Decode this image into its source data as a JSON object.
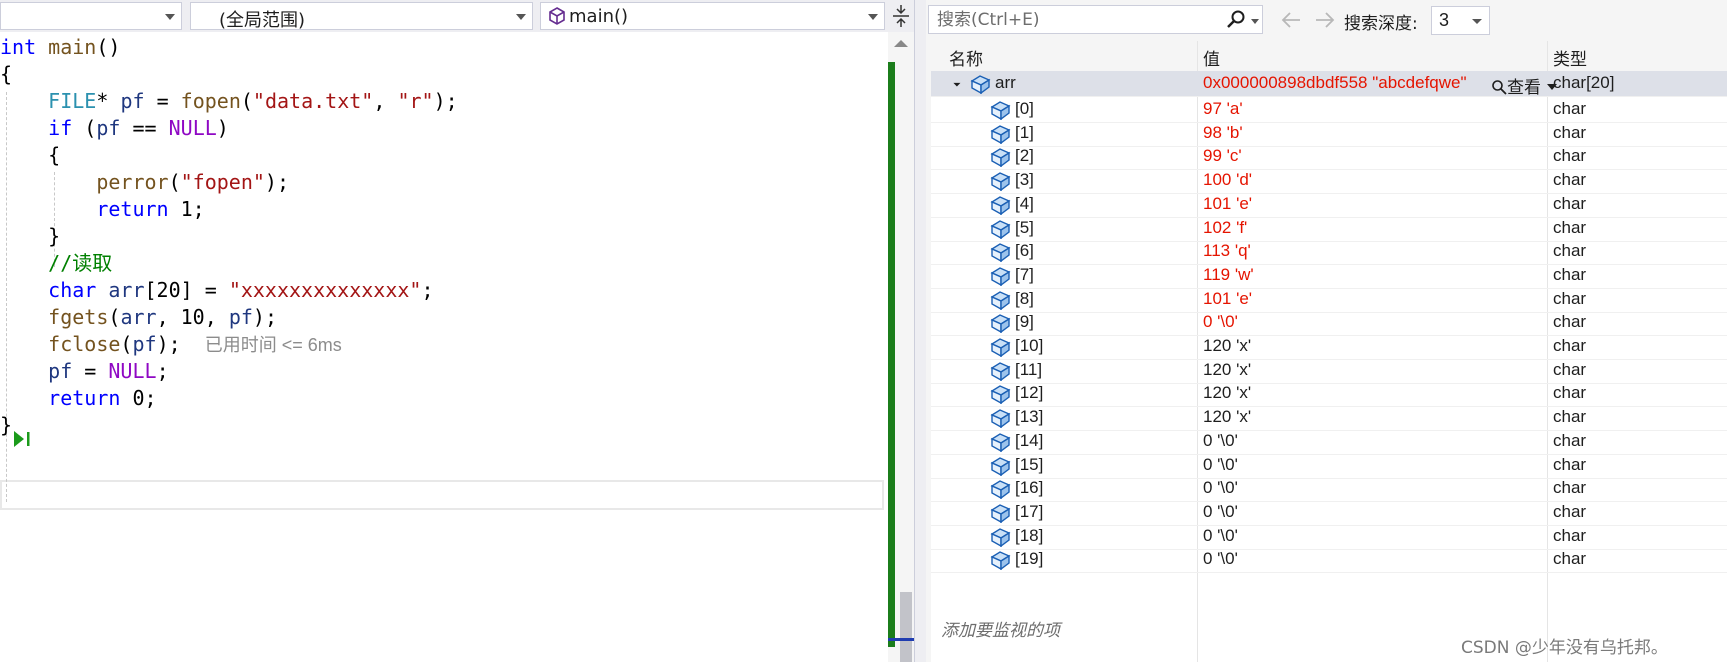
{
  "editor": {
    "nav": {
      "project": "",
      "scope": "(全局范围)",
      "function": "main()"
    },
    "lines": [
      [
        {
          "c": "kw",
          "t": "int"
        },
        {
          "c": "plain",
          "t": " "
        },
        {
          "c": "fn",
          "t": "main"
        },
        {
          "c": "plain",
          "t": "()"
        }
      ],
      [
        {
          "c": "plain",
          "t": "{"
        }
      ],
      [
        {
          "c": "plain",
          "t": "    "
        },
        {
          "c": "ty",
          "t": "FILE"
        },
        {
          "c": "plain",
          "t": "* "
        },
        {
          "c": "var",
          "t": "pf"
        },
        {
          "c": "plain",
          "t": " = "
        },
        {
          "c": "fn",
          "t": "fopen"
        },
        {
          "c": "plain",
          "t": "("
        },
        {
          "c": "str",
          "t": "\"data.txt\""
        },
        {
          "c": "plain",
          "t": ", "
        },
        {
          "c": "str",
          "t": "\"r\""
        },
        {
          "c": "plain",
          "t": ");"
        }
      ],
      [
        {
          "c": "plain",
          "t": "    "
        },
        {
          "c": "kw",
          "t": "if"
        },
        {
          "c": "plain",
          "t": " ("
        },
        {
          "c": "var",
          "t": "pf"
        },
        {
          "c": "plain",
          "t": " == "
        },
        {
          "c": "purple",
          "t": "NULL"
        },
        {
          "c": "plain",
          "t": ")"
        }
      ],
      [
        {
          "c": "plain",
          "t": "    {"
        }
      ],
      [
        {
          "c": "plain",
          "t": "        "
        },
        {
          "c": "fn",
          "t": "perror"
        },
        {
          "c": "plain",
          "t": "("
        },
        {
          "c": "str",
          "t": "\"fopen\""
        },
        {
          "c": "plain",
          "t": ");"
        }
      ],
      [
        {
          "c": "plain",
          "t": "        "
        },
        {
          "c": "kw",
          "t": "return"
        },
        {
          "c": "plain",
          "t": " 1;"
        }
      ],
      [
        {
          "c": "plain",
          "t": "    }"
        }
      ],
      [
        {
          "c": "plain",
          "t": "    "
        },
        {
          "c": "cm",
          "t": "//读取"
        }
      ],
      [
        {
          "c": "plain",
          "t": "    "
        },
        {
          "c": "kw",
          "t": "char"
        },
        {
          "c": "plain",
          "t": " "
        },
        {
          "c": "var",
          "t": "arr"
        },
        {
          "c": "plain",
          "t": "[20] = "
        },
        {
          "c": "str",
          "t": "\"xxxxxxxxxxxxxx\""
        },
        {
          "c": "plain",
          "t": ";"
        }
      ],
      [
        {
          "c": "plain",
          "t": "    "
        },
        {
          "c": "fn",
          "t": "fgets"
        },
        {
          "c": "plain",
          "t": "("
        },
        {
          "c": "var",
          "t": "arr"
        },
        {
          "c": "plain",
          "t": ", 10, "
        },
        {
          "c": "var",
          "t": "pf"
        },
        {
          "c": "plain",
          "t": ");"
        }
      ],
      [
        {
          "c": "plain",
          "t": "    "
        },
        {
          "c": "fn",
          "t": "fclose"
        },
        {
          "c": "plain",
          "t": "("
        },
        {
          "c": "var",
          "t": "pf"
        },
        {
          "c": "plain",
          "t": ");  "
        },
        {
          "c": "hint",
          "t": "已用时间 <= 6ms"
        }
      ],
      [
        {
          "c": "plain",
          "t": "    "
        },
        {
          "c": "var",
          "t": "pf"
        },
        {
          "c": "plain",
          "t": " = "
        },
        {
          "c": "purple",
          "t": "NULL"
        },
        {
          "c": "plain",
          "t": ";"
        }
      ],
      [
        {
          "c": "plain",
          "t": "    "
        },
        {
          "c": "kw",
          "t": "return"
        },
        {
          "c": "plain",
          "t": " 0;"
        }
      ],
      [
        {
          "c": "plain",
          "t": "}"
        }
      ]
    ]
  },
  "watch": {
    "search_placeholder": "搜索(Ctrl+E)",
    "depth_label": "搜索深度:",
    "depth_value": "3",
    "headers": {
      "name": "名称",
      "value": "值",
      "type": "类型"
    },
    "parent": {
      "name": "arr",
      "value": "0x000000898dbdf558 \"abcdefqwe\"",
      "view_label": "查看",
      "type": "char[20]"
    },
    "items": [
      {
        "name": "[0]",
        "value": "97 'a'",
        "type": "char",
        "changed": true
      },
      {
        "name": "[1]",
        "value": "98 'b'",
        "type": "char",
        "changed": true
      },
      {
        "name": "[2]",
        "value": "99 'c'",
        "type": "char",
        "changed": true
      },
      {
        "name": "[3]",
        "value": "100 'd'",
        "type": "char",
        "changed": true
      },
      {
        "name": "[4]",
        "value": "101 'e'",
        "type": "char",
        "changed": true
      },
      {
        "name": "[5]",
        "value": "102 'f'",
        "type": "char",
        "changed": true
      },
      {
        "name": "[6]",
        "value": "113 'q'",
        "type": "char",
        "changed": true
      },
      {
        "name": "[7]",
        "value": "119 'w'",
        "type": "char",
        "changed": true
      },
      {
        "name": "[8]",
        "value": "101 'e'",
        "type": "char",
        "changed": true
      },
      {
        "name": "[9]",
        "value": "0 '\\0'",
        "type": "char",
        "changed": true
      },
      {
        "name": "[10]",
        "value": "120 'x'",
        "type": "char",
        "changed": false
      },
      {
        "name": "[11]",
        "value": "120 'x'",
        "type": "char",
        "changed": false
      },
      {
        "name": "[12]",
        "value": "120 'x'",
        "type": "char",
        "changed": false
      },
      {
        "name": "[13]",
        "value": "120 'x'",
        "type": "char",
        "changed": false
      },
      {
        "name": "[14]",
        "value": "0 '\\0'",
        "type": "char",
        "changed": false
      },
      {
        "name": "[15]",
        "value": "0 '\\0'",
        "type": "char",
        "changed": false
      },
      {
        "name": "[16]",
        "value": "0 '\\0'",
        "type": "char",
        "changed": false
      },
      {
        "name": "[17]",
        "value": "0 '\\0'",
        "type": "char",
        "changed": false
      },
      {
        "name": "[18]",
        "value": "0 '\\0'",
        "type": "char",
        "changed": false
      },
      {
        "name": "[19]",
        "value": "0 '\\0'",
        "type": "char",
        "changed": false
      }
    ],
    "add_watch_text": "添加要监视的项"
  },
  "watermark": "CSDN @少年没有乌托邦。",
  "colors": {
    "changed_value": "#e51400",
    "scroll_green": "#1b7d1b",
    "selected_row": "#dde0e8"
  },
  "icons": [
    "cube-icon",
    "search-icon",
    "back-arrow-icon",
    "forward-arrow-icon",
    "object-icon",
    "magnifier-icon",
    "execution-pointer-icon",
    "split-handle-icon"
  ]
}
